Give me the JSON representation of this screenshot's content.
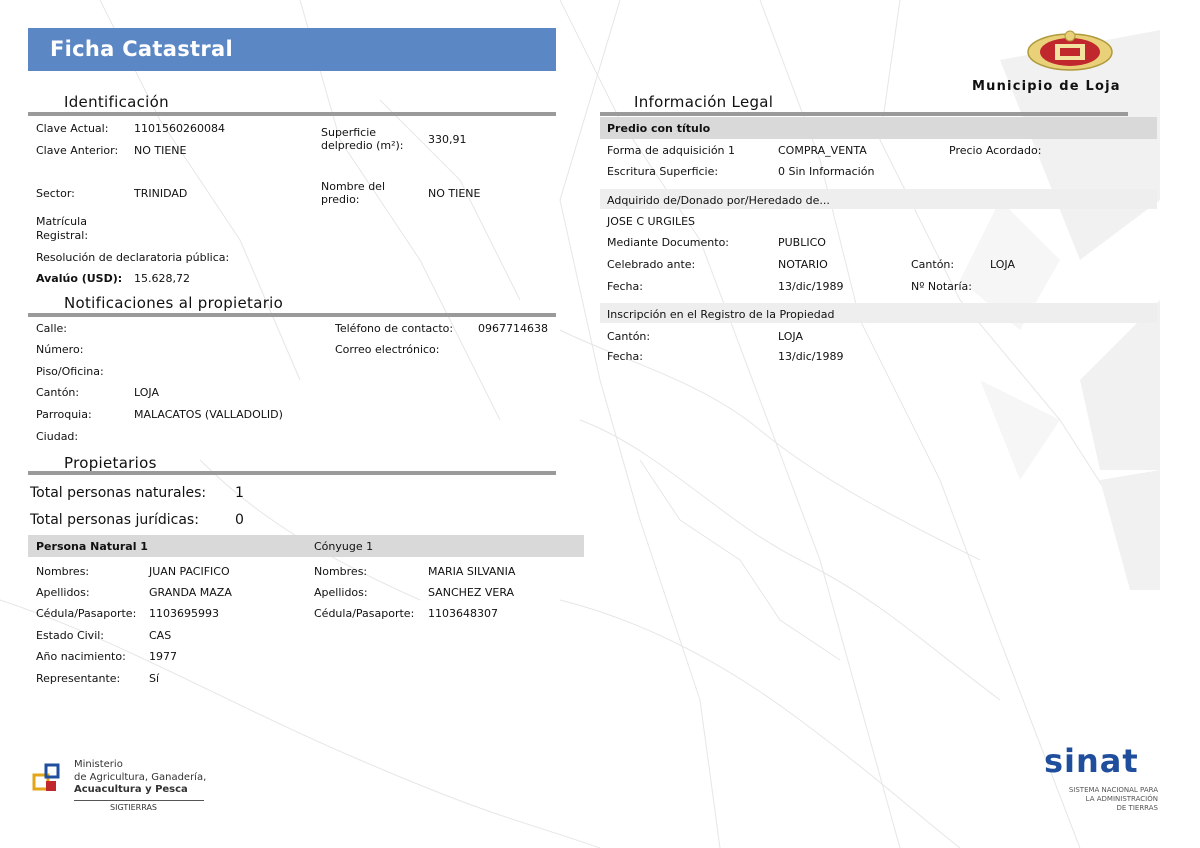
{
  "header": {
    "title": "Ficha Catastral",
    "municipio": "Municipio de Loja"
  },
  "identificacion": {
    "section_title": "Identificación",
    "clave_actual_label": "Clave Actual:",
    "clave_actual": "1101560260084",
    "clave_anterior_label": "Clave Anterior:",
    "clave_anterior": "NO TIENE",
    "superficie_label_1": "Superficie",
    "superficie_label_2": "delpredio (m²):",
    "superficie": "330,91",
    "sector_label": "Sector:",
    "sector": "TRINIDAD",
    "nombre_predio_label_1": "Nombre del",
    "nombre_predio_label_2": "predio:",
    "nombre_predio": "NO TIENE",
    "matricula_label_1": "Matrícula",
    "matricula_label_2": "Registral:",
    "resolucion_label": "Resolución de declaratoria pública:",
    "avaluo_label": "Avalúo (USD):",
    "avaluo": "15.628,72"
  },
  "notificaciones": {
    "section_title": "Notificaciones al propietario",
    "calle_label": "Calle:",
    "numero_label": "Número:",
    "piso_label": "Piso/Oficina:",
    "canton_label": "Cantón:",
    "canton": "LOJA",
    "parroquia_label": "Parroquia:",
    "parroquia": "MALACATOS (VALLADOLID)",
    "ciudad_label": "Ciudad:",
    "telefono_label": "Teléfono de contacto:",
    "telefono": "0967714638",
    "correo_label": "Correo electrónico:"
  },
  "propietarios": {
    "section_title": "Propietarios",
    "naturales_label": "Total personas naturales:",
    "naturales": "1",
    "juridicas_label": "Total personas jurídicas:",
    "juridicas": "0",
    "persona_header": "Persona Natural 1",
    "conyuge_header": "Cónyuge 1",
    "persona": {
      "nombres_label": "Nombres:",
      "nombres": "JUAN PACIFICO",
      "apellidos_label": "Apellidos:",
      "apellidos": "GRANDA MAZA",
      "cedula_label": "Cédula/Pasaporte:",
      "cedula": "1103695993",
      "estado_label": "Estado Civil:",
      "estado": "CAS",
      "anio_label": "Año nacimiento:",
      "anio": "1977",
      "representante_label": "Representante:",
      "representante": "Sí"
    },
    "conyuge": {
      "nombres_label": "Nombres:",
      "nombres": "MARIA SILVANIA",
      "apellidos_label": "Apellidos:",
      "apellidos": "SANCHEZ VERA",
      "cedula_label": "Cédula/Pasaporte:",
      "cedula": "1103648307"
    }
  },
  "legal": {
    "section_title": "Información Legal",
    "predio_header": "Predio con título",
    "forma_label": "Forma de adquisición 1",
    "forma": "COMPRA_VENTA",
    "precio_label": "Precio Acordado:",
    "escritura_label": "Escritura Superficie:",
    "escritura": "0 Sin Información",
    "adquirido_header": "Adquirido de/Donado por/Heredado de...",
    "adquirido": "JOSE C URGILES",
    "documento_label": "Mediante Documento:",
    "documento": "PUBLICO",
    "celebrado_label": "Celebrado ante:",
    "celebrado": "NOTARIO",
    "canton_label": "Cantón:",
    "canton": "LOJA",
    "fecha_label": "Fecha:",
    "fecha": "13/dic/1989",
    "notaria_label": "Nº Notaría:",
    "inscripcion_header": "Inscripción en el Registro de la Propiedad",
    "ins_canton_label": "Cantón:",
    "ins_canton": "LOJA",
    "ins_fecha_label": "Fecha:",
    "ins_fecha": "13/dic/1989"
  },
  "footer": {
    "ministerio_1": "Ministerio",
    "ministerio_2": "de Agricultura, Ganadería,",
    "ministerio_3": "Acuacultura y Pesca",
    "sigtierras": "SIGTIERRAS",
    "sinat": "sinat",
    "sinat_1": "SISTEMA NACIONAL PARA",
    "sinat_2": "LA ADMINISTRACIÓN",
    "sinat_3": "DE TIERRAS"
  },
  "colors": {
    "title_bar": "#5b87c4",
    "section_rule": "#9a9a9a",
    "header_grey": "#d9d9d9",
    "band_grey": "#eeeeee",
    "sinat_blue": "#1f4f9c",
    "municipio_red": "#c0282d"
  }
}
